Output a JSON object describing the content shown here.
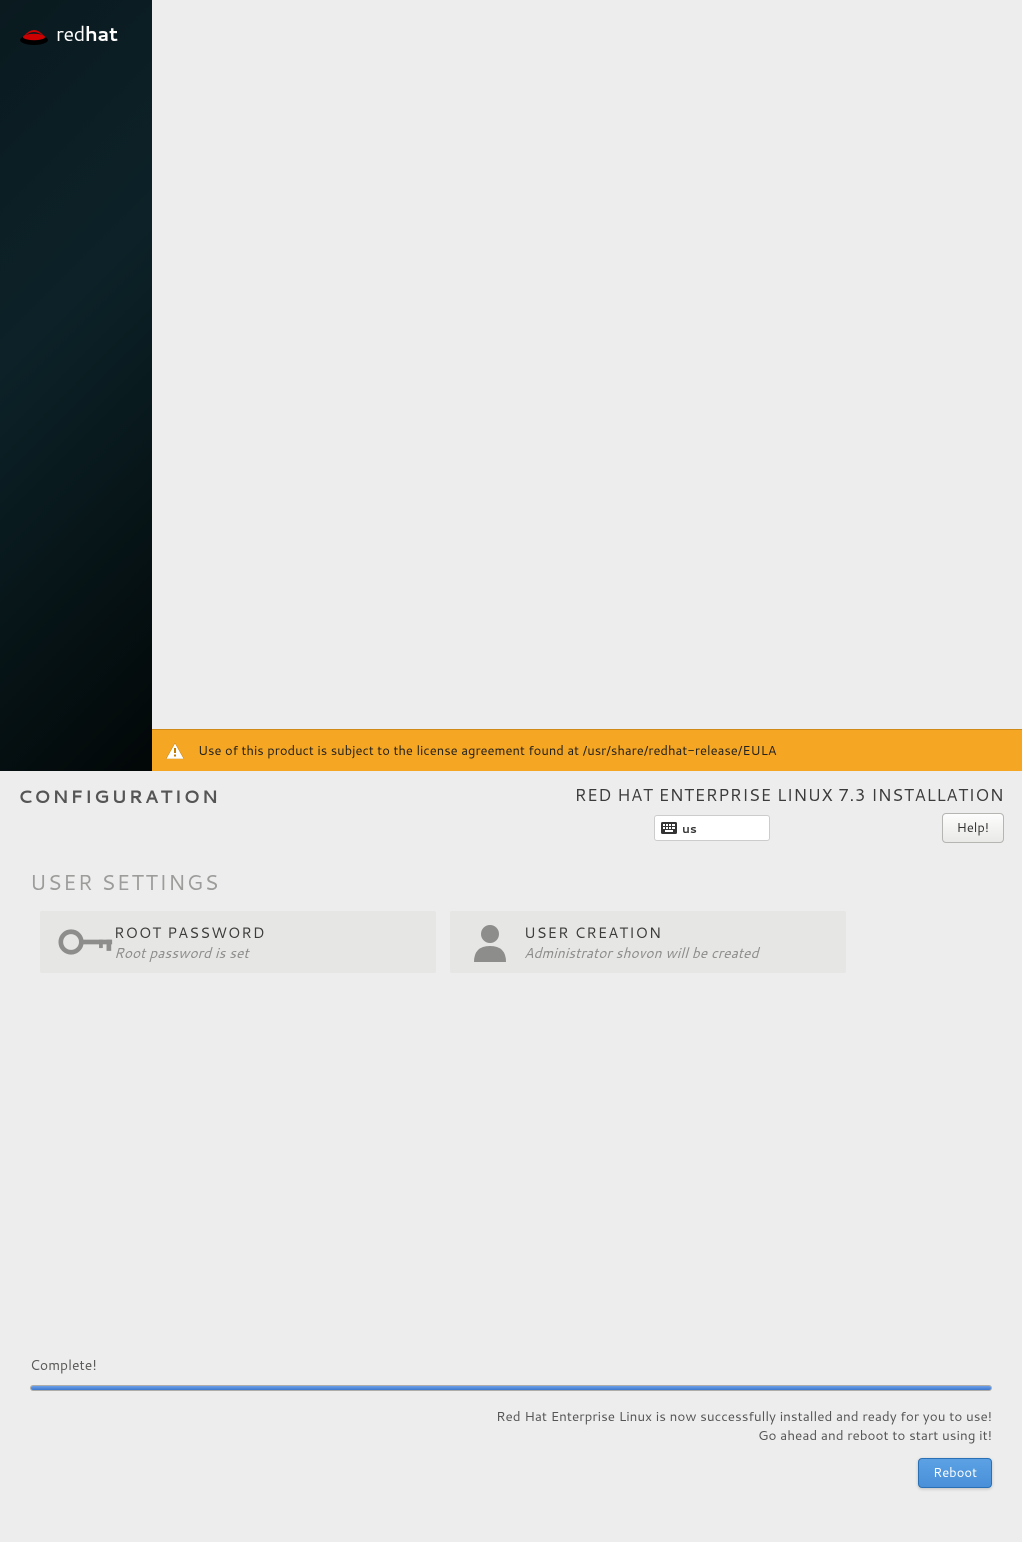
{
  "logo": {
    "brand": "red",
    "brand_bold": "hat"
  },
  "header": {
    "config_label": "CONFIGURATION",
    "install_title": "RED HAT ENTERPRISE LINUX 7.3 INSTALLATION",
    "keyboard_layout": "us",
    "help_label": "Help!"
  },
  "user_settings": {
    "section_title": "USER SETTINGS",
    "root": {
      "title": "ROOT PASSWORD",
      "subtitle": "Root password is set"
    },
    "user": {
      "title": "USER CREATION",
      "subtitle": "Administrator shovon will be created"
    }
  },
  "progress": {
    "status": "Complete!",
    "percent": 100,
    "message_line1": "Red Hat Enterprise Linux is now successfully installed and ready for you to use!",
    "message_line2": "Go ahead and reboot to start using it!",
    "reboot_label": "Reboot"
  },
  "eula": {
    "text": "Use of this product is subject to the license agreement found at /usr/share/redhat-release/EULA"
  }
}
